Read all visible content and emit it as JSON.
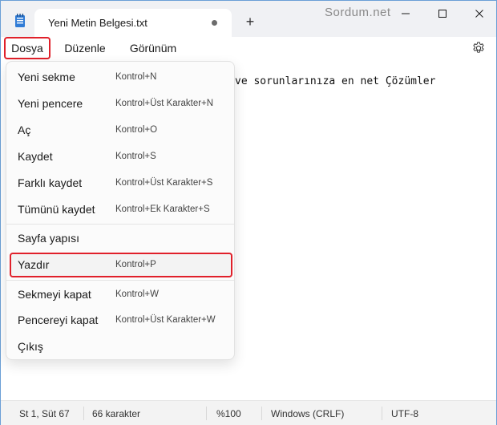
{
  "titlebar": {
    "tab_title": "Yeni Metin Belgesi.txt",
    "new_tab_symbol": "+",
    "watermark": "Sordum.net"
  },
  "menubar": {
    "items": [
      "Dosya",
      "Düzenle",
      "Görünüm"
    ]
  },
  "editor": {
    "visible_text": "ve sorunlarınıza en net Çözümler"
  },
  "file_menu": {
    "items": [
      {
        "label": "Yeni sekme",
        "shortcut": "Kontrol+N"
      },
      {
        "label": "Yeni pencere",
        "shortcut": "Kontrol+Üst Karakter+N"
      },
      {
        "label": "Aç",
        "shortcut": "Kontrol+O"
      },
      {
        "label": "Kaydet",
        "shortcut": "Kontrol+S"
      },
      {
        "label": "Farklı kaydet",
        "shortcut": "Kontrol+Üst Karakter+S"
      },
      {
        "label": "Tümünü kaydet",
        "shortcut": "Kontrol+Ek Karakter+S"
      },
      {
        "label": "Sayfa yapısı",
        "shortcut": ""
      },
      {
        "label": "Yazdır",
        "shortcut": "Kontrol+P"
      },
      {
        "label": "Sekmeyi kapat",
        "shortcut": "Kontrol+W"
      },
      {
        "label": "Pencereyi kapat",
        "shortcut": "Kontrol+Üst Karakter+W"
      },
      {
        "label": "Çıkış",
        "shortcut": ""
      }
    ]
  },
  "statusbar": {
    "position": "St 1, Süt 67",
    "char_count": "66 karakter",
    "zoom": "%100",
    "line_ending": "Windows (CRLF)",
    "encoding": "UTF-8"
  },
  "colors": {
    "highlight": "#e0202a",
    "titlebar_bg": "#f0f1f4",
    "statusbar_bg": "#f3f3f3"
  },
  "icons": {
    "app": "notepad-icon",
    "settings": "gear-icon",
    "minimize": "minimize-icon",
    "maximize": "maximize-icon",
    "close": "close-icon"
  }
}
